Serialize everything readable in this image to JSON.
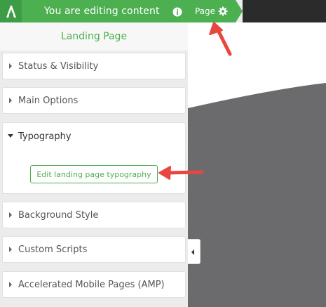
{
  "topbar": {
    "title": "You are editing content",
    "page_tab_label": "Page"
  },
  "sidebar": {
    "panel_title": "Landing Page",
    "sections": [
      {
        "label": "Status & Visibility",
        "expanded": false
      },
      {
        "label": "Main Options",
        "expanded": false
      },
      {
        "label": "Typography",
        "expanded": true
      },
      {
        "label": "Background Style",
        "expanded": false
      },
      {
        "label": "Custom Scripts",
        "expanded": false
      },
      {
        "label": "Accelerated Mobile Pages (AMP)",
        "expanded": false
      }
    ],
    "typography_button": "Edit landing page typography"
  },
  "colors": {
    "brand_green": "#4caf50",
    "annotation_red": "#e8473f",
    "preview_shape": "#6b6b6d"
  },
  "icons": [
    "logo-icon",
    "info-icon",
    "gear-icon",
    "collapse-arrow-icon"
  ]
}
